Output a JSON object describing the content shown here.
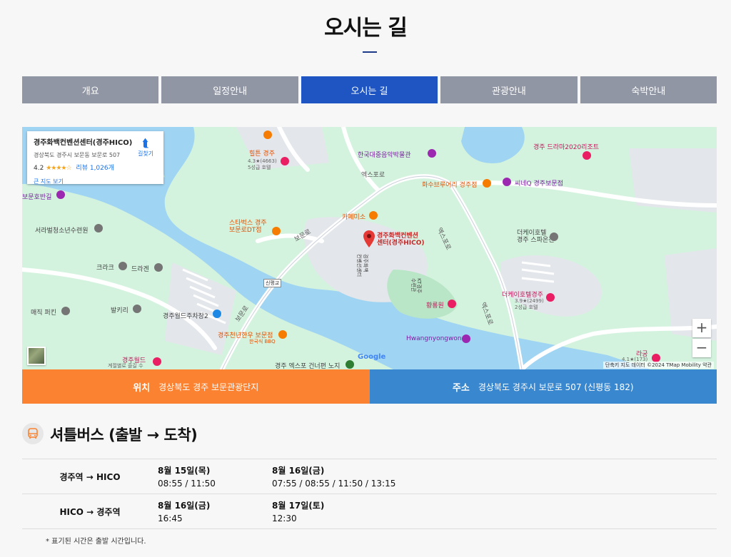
{
  "page": {
    "title": "오시는 길"
  },
  "tabs": [
    "개요",
    "일정안내",
    "오시는 길",
    "관광안내",
    "숙박안내"
  ],
  "active_tab": "오시는 길",
  "map": {
    "place_card": {
      "name": "경주화백컨벤션센터(경주HICO)",
      "address": "경상북도 경주시 보문동 보문로 507",
      "rating": "4.2",
      "stars": "★★★★☆",
      "reviews": "리뷰 1,026개",
      "larger_map": "큰 지도 보기",
      "directions": "길찾기"
    },
    "labels": {
      "hico": "경주화백컨벤션\n센터(경주HICO)",
      "hilton": "힐튼 경주",
      "hilton_sub": "4.3★(4663)\n5성급 호텔",
      "music_hall": "한국대중음악박물관",
      "expo_road1": "엑스포로",
      "hwasu": "화수브루어리 경주점",
      "cinema": "씨네Q 경주보문점",
      "drama": "경주 드라마2020리조트",
      "cafe": "카페미소",
      "starbucks": "스타벅스 경주\n보문로DT점",
      "bomun_road": "보문로",
      "bomun_road2": "보문로",
      "expo_road2": "엑스포로",
      "expo_road3": "엑스포로",
      "the_k": "더케이호텔\n경주 스파온천",
      "the_k2": "더케이호텔경주",
      "the_k2_sub": "3.9★(2499)\n2성급 호텔",
      "seorabeol": "서라벌청소년수련원",
      "bomunho": "보문호반길",
      "crack": "크라크",
      "dragon": "드라겐",
      "magic": "매직 퍼킨",
      "balkiri": "발키리",
      "parking": "경주월드주차장2",
      "sinpyeong": "신평교",
      "hanwoo": "경주천년한우 보문점",
      "hanwoo_sub": "한국식 BBQ",
      "hwangnyong": "황룡원",
      "hwangnyongwon": "Hwangnyongwon",
      "kt": "KT경주\n수련관",
      "gyeongjuworld": "경주월드",
      "gyeongjuworld_sub": "계절별로 즐길 수",
      "expo_bridge": "경주 엑스포 건너편 노지",
      "rag": "라궁",
      "rag_sub": "4.1★(173)",
      "hico_bldg": "경주화백\n컨벤션센터",
      "google": "Google",
      "attribution": "단축키   지도 데이터 ©2024 TMap Mobility   약관"
    }
  },
  "info": {
    "location_label": "위치",
    "location_value": "경상북도 경주 보문관광단지",
    "address_label": "주소",
    "address_value": "경상북도 경주시 보문로 507 (신평동 182)"
  },
  "shuttle": {
    "title": "셔틀버스 (출발 → 도착)",
    "rows": [
      {
        "route": "경주역 → HICO",
        "d1": "8월 15일(목)",
        "t1": "08:55 / 11:50",
        "d2": "8월 16일(금)",
        "t2": "07:55 / 08:55 / 11:50 / 13:15"
      },
      {
        "route": "HICO → 경주역",
        "d1": "8월 16일(금)",
        "t1": "16:45",
        "d2": "8월 17일(토)",
        "t2": "12:30"
      }
    ],
    "note": "* 표기된 시간은 출발 시간입니다."
  },
  "colors": {
    "active_tab": "#1e55c3",
    "tab": "#9196a4",
    "location": "#fb8230",
    "address": "#3987cf"
  }
}
